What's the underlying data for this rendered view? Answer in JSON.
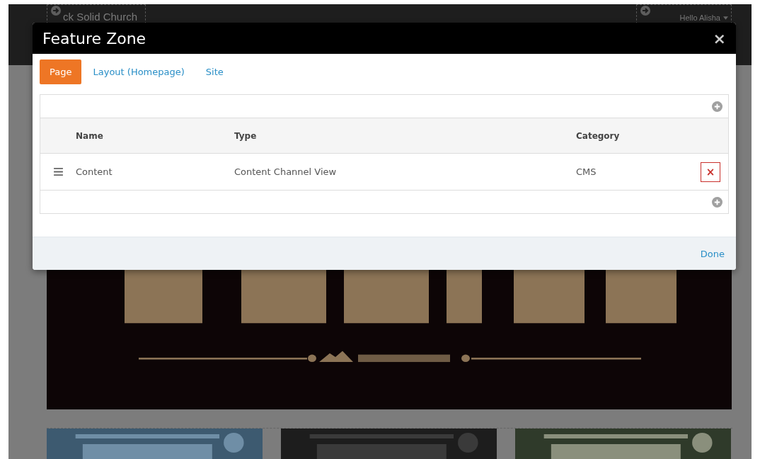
{
  "site_header": {
    "brand": "ck Solid Church",
    "user_menu": "Hello Alisha"
  },
  "modal": {
    "title": "Feature Zone",
    "close": "×",
    "tabs": [
      {
        "label": "Page",
        "selected": true
      },
      {
        "label": "Layout (Homepage)",
        "selected": false
      },
      {
        "label": "Site",
        "selected": false
      }
    ],
    "table": {
      "columns": [
        "Name",
        "Type",
        "Category"
      ],
      "rows": [
        {
          "name": "Content",
          "type": "Content Channel View",
          "category": "CMS",
          "delete": "×"
        }
      ]
    },
    "done": "Done"
  }
}
